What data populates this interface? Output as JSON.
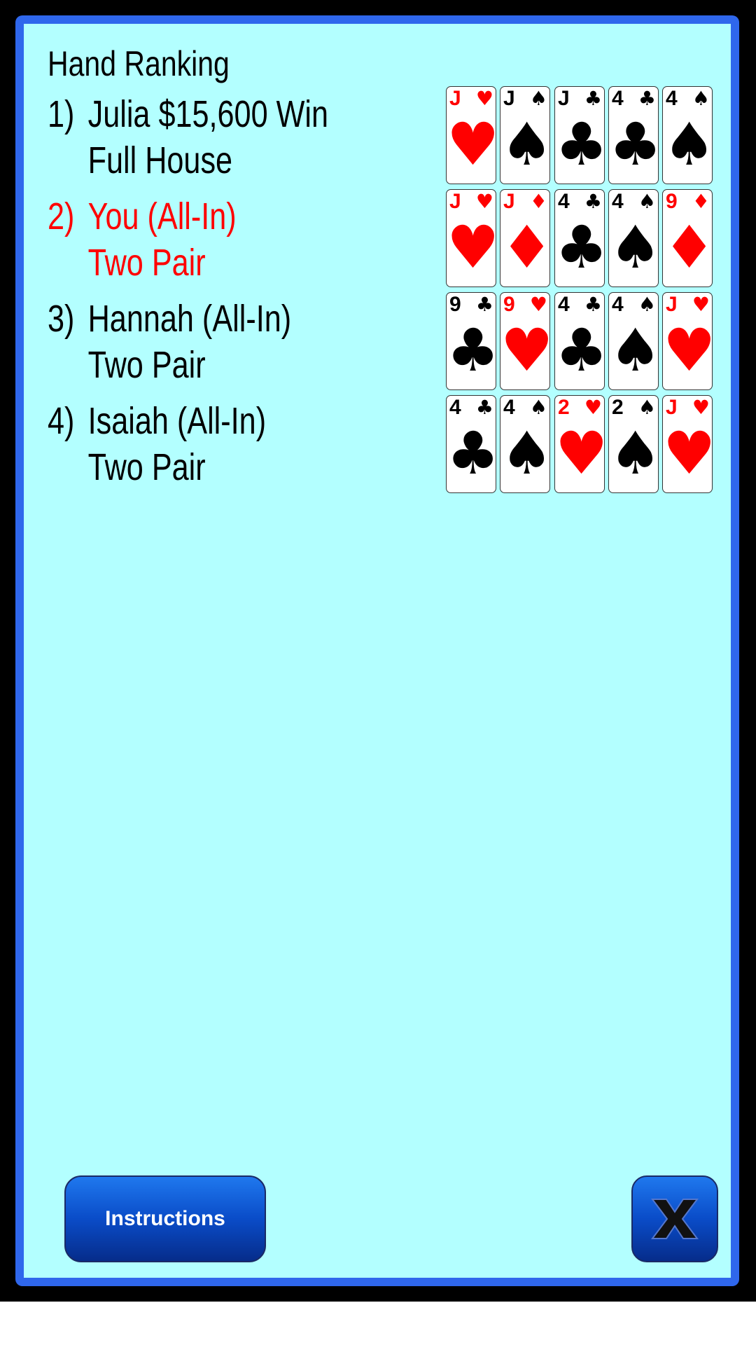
{
  "ranking": {
    "title": "Hand Ranking",
    "entries": [
      {
        "num": "1)",
        "line1": "Julia $15,600 Win",
        "line2": "Full House",
        "highlight": false
      },
      {
        "num": "2)",
        "line1": "You (All-In)",
        "line2": "Two Pair",
        "highlight": true
      },
      {
        "num": "3)",
        "line1": "Hannah (All-In)",
        "line2": "Two Pair",
        "highlight": false
      },
      {
        "num": "4)",
        "line1": "Isaiah (All-In)",
        "line2": "Two Pair",
        "highlight": false
      }
    ]
  },
  "hands": [
    [
      {
        "rank": "J",
        "suit": "hearts"
      },
      {
        "rank": "J",
        "suit": "spades"
      },
      {
        "rank": "J",
        "suit": "clubs"
      },
      {
        "rank": "4",
        "suit": "clubs"
      },
      {
        "rank": "4",
        "suit": "spades"
      }
    ],
    [
      {
        "rank": "J",
        "suit": "hearts"
      },
      {
        "rank": "J",
        "suit": "diamonds"
      },
      {
        "rank": "4",
        "suit": "clubs"
      },
      {
        "rank": "4",
        "suit": "spades"
      },
      {
        "rank": "9",
        "suit": "diamonds"
      }
    ],
    [
      {
        "rank": "9",
        "suit": "clubs"
      },
      {
        "rank": "9",
        "suit": "hearts"
      },
      {
        "rank": "4",
        "suit": "clubs"
      },
      {
        "rank": "4",
        "suit": "spades"
      },
      {
        "rank": "J",
        "suit": "hearts"
      }
    ],
    [
      {
        "rank": "4",
        "suit": "clubs"
      },
      {
        "rank": "4",
        "suit": "spades"
      },
      {
        "rank": "2",
        "suit": "hearts"
      },
      {
        "rank": "2",
        "suit": "spades"
      },
      {
        "rank": "J",
        "suit": "hearts"
      }
    ]
  ],
  "buttons": {
    "instructions_label": "Instructions",
    "close_icon": "close-x-icon"
  },
  "colors": {
    "panel_background": "#b3ffff",
    "panel_border": "#2f67ec",
    "highlight_text": "#ff0000",
    "button_blue": "#0a4cc8"
  }
}
